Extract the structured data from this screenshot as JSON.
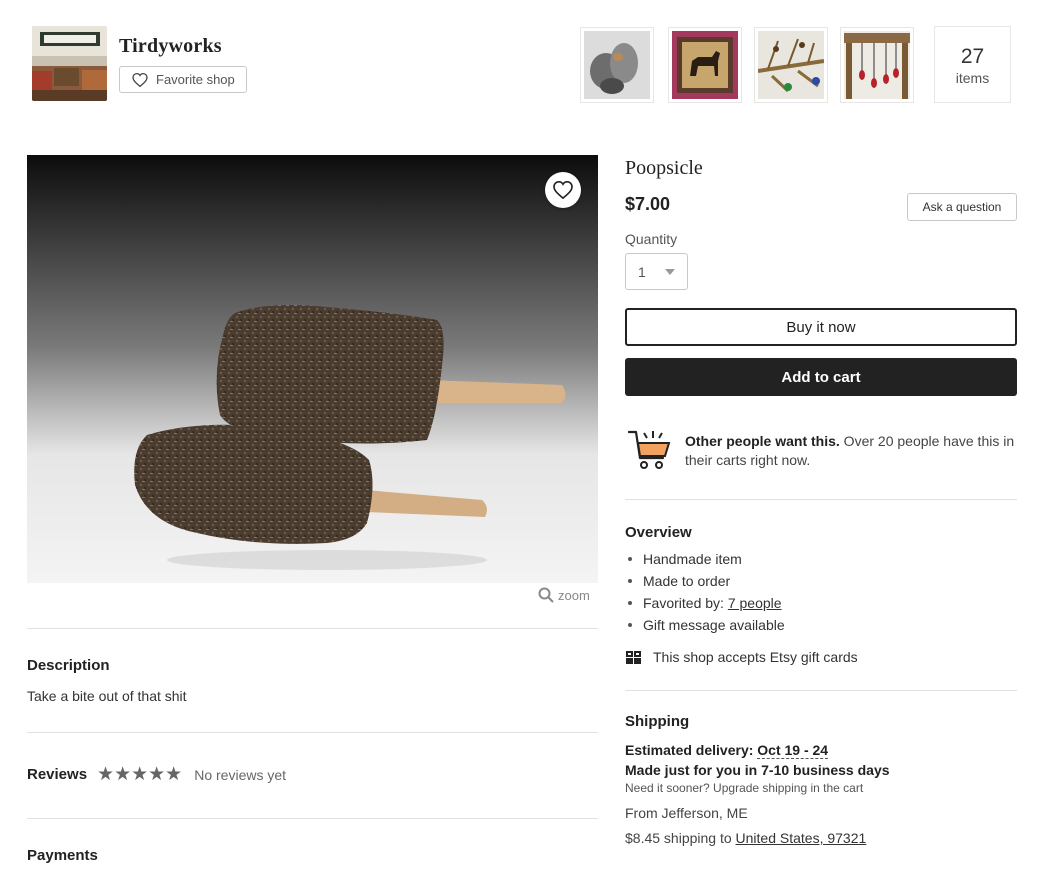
{
  "shop": {
    "name": "Tirdyworks",
    "favorite_label": "Favorite shop",
    "items_count": "27",
    "items_label": "items"
  },
  "listing": {
    "title": "Poopsicle",
    "price": "$7.00",
    "ask_question_label": "Ask a question",
    "quantity_label": "Quantity",
    "quantity_value": "1",
    "buy_now_label": "Buy it now",
    "add_to_cart_label": "Add to cart",
    "zoom_label": "zoom"
  },
  "demand": {
    "bold": "Other people want this.",
    "text": " Over 20 people have this in their carts right now."
  },
  "overview": {
    "title": "Overview",
    "items": [
      "Handmade item",
      "Made to order",
      "Favorited by: ",
      "Gift message available"
    ],
    "favorited_link": "7 people",
    "gift_cards": "This shop accepts Etsy gift cards"
  },
  "shipping": {
    "title": "Shipping",
    "estimated_label": "Estimated delivery: ",
    "estimated_dates": "Oct 19 - 24",
    "made_for_you": "Made just for you in 7-10 business days",
    "need_sooner": "Need it sooner? Upgrade shipping in the cart",
    "from": "From Jefferson, ME",
    "cost_prefix": "$8.45 shipping to ",
    "destination": "United States, 97321"
  },
  "description": {
    "title": "Description",
    "text": "Take a bite out of that shit"
  },
  "reviews": {
    "title": "Reviews",
    "stars": "★★★★★",
    "status": "No reviews yet"
  },
  "payments": {
    "title": "Payments"
  },
  "colors": {
    "accent_orange": "#f1641e",
    "dark_button": "#222222",
    "divider": "#e1e1e1"
  }
}
